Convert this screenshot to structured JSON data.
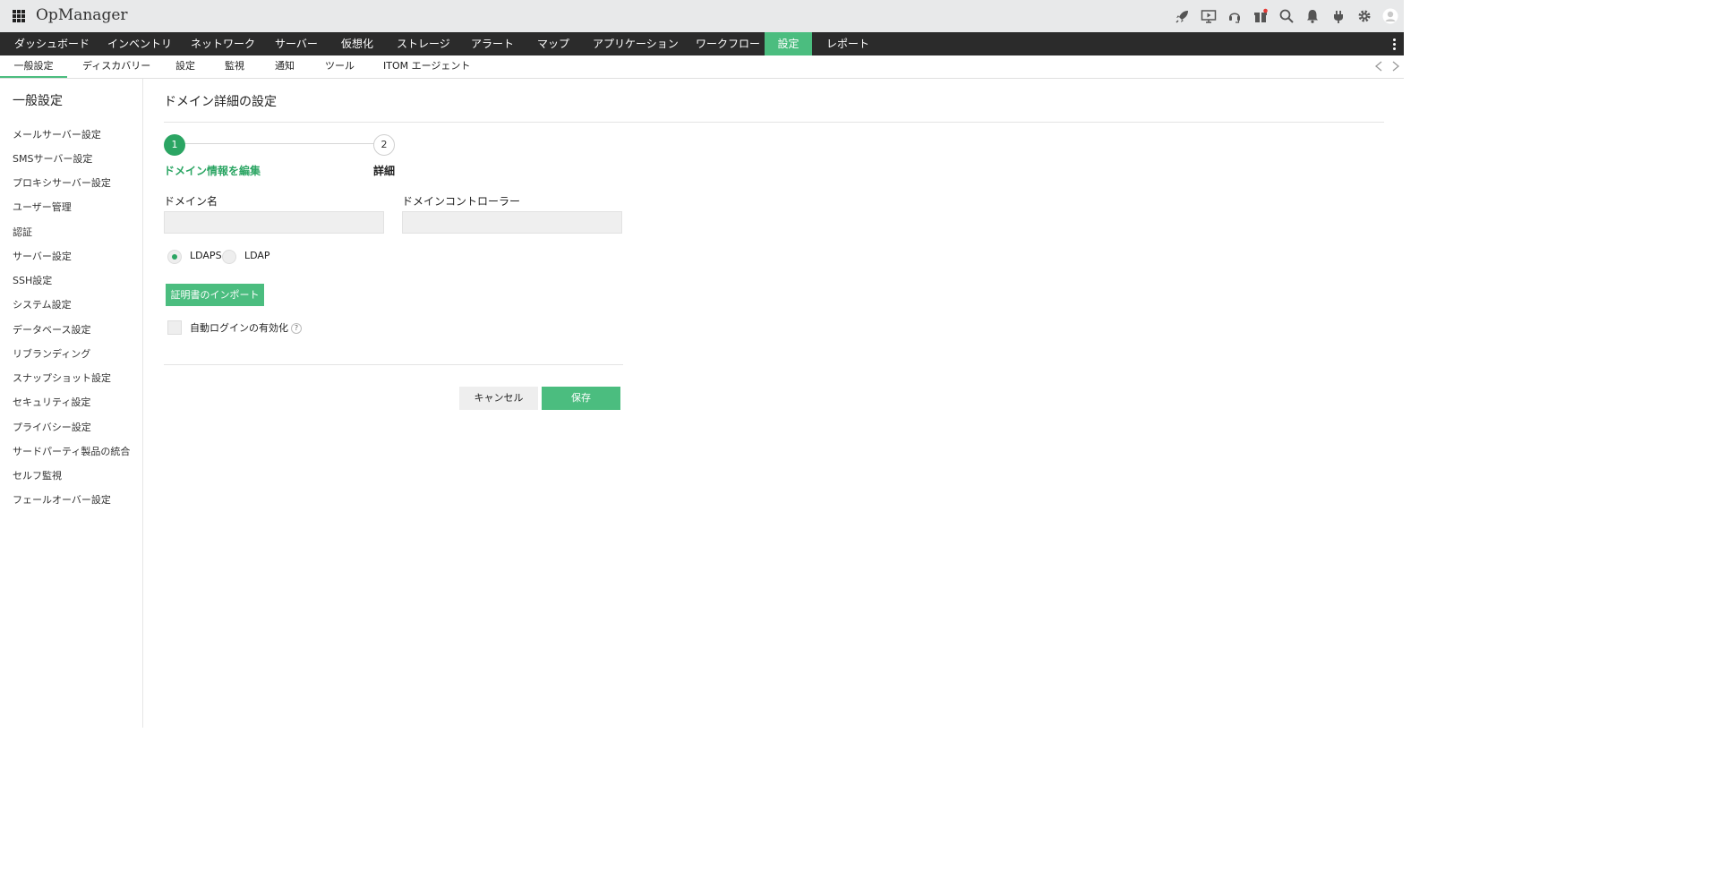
{
  "app": {
    "title": "OpManager"
  },
  "header_icons": [
    "rocket-icon",
    "video-tutorial-icon",
    "support-icon",
    "gift-icon",
    "search-icon",
    "bell-icon",
    "plug-icon",
    "gear-icon",
    "user-avatar-icon"
  ],
  "colors": {
    "accent": "#4bbd7f",
    "accent_dark": "#2ba563",
    "nav_bg": "#2b2b2b",
    "header_bg": "#e8e9ea",
    "notification_dot": "#e53935"
  },
  "main_nav": {
    "items": [
      {
        "label": "ダッシュボード",
        "active": false
      },
      {
        "label": "インベントリ",
        "active": false
      },
      {
        "label": "ネットワーク",
        "active": false
      },
      {
        "label": "サーバー",
        "active": false
      },
      {
        "label": "仮想化",
        "active": false
      },
      {
        "label": "ストレージ",
        "active": false
      },
      {
        "label": "アラート",
        "active": false
      },
      {
        "label": "マップ",
        "active": false
      },
      {
        "label": "アプリケーション",
        "active": false
      },
      {
        "label": "ワークフロー",
        "active": false
      },
      {
        "label": "設定",
        "active": true
      },
      {
        "label": "レポート",
        "active": false
      }
    ]
  },
  "sub_nav": {
    "items": [
      {
        "label": "一般設定",
        "active": true
      },
      {
        "label": "ディスカバリー",
        "active": false
      },
      {
        "label": "設定",
        "active": false
      },
      {
        "label": "監視",
        "active": false
      },
      {
        "label": "通知",
        "active": false
      },
      {
        "label": "ツール",
        "active": false
      },
      {
        "label": "ITOM エージェント",
        "active": false
      }
    ]
  },
  "sidebar": {
    "title": "一般設定",
    "items": [
      {
        "label": "メールサーバー設定"
      },
      {
        "label": "SMSサーバー設定"
      },
      {
        "label": "プロキシサーバー設定"
      },
      {
        "label": "ユーザー管理"
      },
      {
        "label": "認証"
      },
      {
        "label": "サーバー設定"
      },
      {
        "label": "SSH設定"
      },
      {
        "label": "システム設定"
      },
      {
        "label": "データベース設定"
      },
      {
        "label": "リブランディング"
      },
      {
        "label": "スナップショット設定"
      },
      {
        "label": "セキュリティ設定"
      },
      {
        "label": "プライバシー設定"
      },
      {
        "label": "サードパーティ製品の統合"
      },
      {
        "label": "セルフ監視"
      },
      {
        "label": "フェールオーバー設定"
      }
    ]
  },
  "form": {
    "title": "ドメイン詳細の設定",
    "steps": [
      {
        "number": "1",
        "label": "ドメイン情報を編集",
        "active": true
      },
      {
        "number": "2",
        "label": "詳細",
        "active": false
      }
    ],
    "domain_name": {
      "label": "ドメイン名",
      "value": "",
      "placeholder": ""
    },
    "domain_controller": {
      "label": "ドメインコントローラー",
      "value": "",
      "placeholder": ""
    },
    "protocol": {
      "options": [
        {
          "label": "LDAPS",
          "checked": true
        },
        {
          "label": "LDAP",
          "checked": false
        }
      ]
    },
    "import_cert_label": "証明書のインポート",
    "auto_login": {
      "label": "自動ログインの有効化",
      "checked": false,
      "help": "?"
    },
    "cancel_label": "キャンセル",
    "save_label": "保存"
  }
}
